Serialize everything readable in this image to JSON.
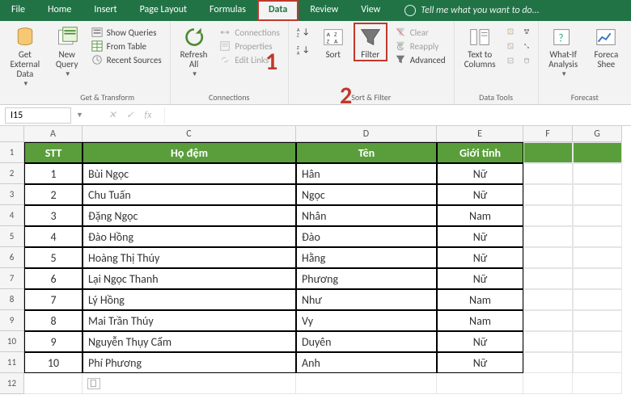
{
  "tabs": {
    "file": "File",
    "home": "Home",
    "insert": "Insert",
    "page_layout": "Page Layout",
    "formulas": "Formulas",
    "data": "Data",
    "review": "Review",
    "view": "View",
    "tell_me": "Tell me what you want to do..."
  },
  "ribbon": {
    "get_external": "Get External\nData",
    "new_query": "New\nQuery",
    "show_queries": "Show Queries",
    "from_table": "From Table",
    "recent_sources": "Recent Sources",
    "group_get_transform": "Get & Transform",
    "refresh_all": "Refresh\nAll",
    "connections": "Connections",
    "properties": "Properties",
    "edit_links": "Edit Links",
    "group_connections": "Connections",
    "sort_az_small": "A↓Z",
    "sort_za_small": "Z↓A",
    "sort_big": "Sort",
    "filter": "Filter",
    "clear": "Clear",
    "reapply": "Reapply",
    "advanced": "Advanced",
    "group_sort_filter": "Sort & Filter",
    "text_to_columns": "Text to\nColumns",
    "group_data_tools": "Data Tools",
    "what_if": "What-If\nAnalysis",
    "forecast_sheet": "Foreca\nShee",
    "group_forecast": "Forecast"
  },
  "annotations": {
    "one": "1",
    "two": "2"
  },
  "formula_bar": {
    "name_box": "I15",
    "fx": "fx"
  },
  "col_headers": {
    "A": "A",
    "C": "C",
    "D": "D",
    "E": "E",
    "F": "F",
    "G": "G"
  },
  "table": {
    "headers": {
      "stt": "STT",
      "ho_dem": "Họ đệm",
      "ten": "Tên",
      "gioi_tinh": "Giới tính"
    },
    "rows": [
      {
        "n": "1",
        "stt": "1",
        "ho": "Bùi Ngọc",
        "ten": "Hân",
        "gt": "Nữ"
      },
      {
        "n": "2",
        "stt": "2",
        "ho": "Chu Tuấn",
        "ten": "Ngọc",
        "gt": "Nữ"
      },
      {
        "n": "3",
        "stt": "3",
        "ho": "Đặng Ngọc",
        "ten": "Nhân",
        "gt": "Nam"
      },
      {
        "n": "4",
        "stt": "4",
        "ho": "Đào Hồng",
        "ten": "Đào",
        "gt": "Nữ"
      },
      {
        "n": "5",
        "stt": "5",
        "ho": "Hoàng Thị Thúy",
        "ten": "Hằng",
        "gt": "Nữ"
      },
      {
        "n": "6",
        "stt": "6",
        "ho": "Lại Ngọc Thanh",
        "ten": "Phương",
        "gt": "Nữ"
      },
      {
        "n": "7",
        "stt": "7",
        "ho": "Lý Hồng",
        "ten": "Như",
        "gt": "Nam"
      },
      {
        "n": "8",
        "stt": "8",
        "ho": "Mai Trần Thúy",
        "ten": "Vy",
        "gt": "Nam"
      },
      {
        "n": "9",
        "stt": "9",
        "ho": "Nguyễn Thụy Cẩm",
        "ten": "Duyên",
        "gt": "Nữ"
      },
      {
        "n": "10",
        "stt": "10",
        "ho": "Phí Phương",
        "ten": "Anh",
        "gt": "Nữ"
      }
    ],
    "extra_rows": [
      "12"
    ]
  }
}
